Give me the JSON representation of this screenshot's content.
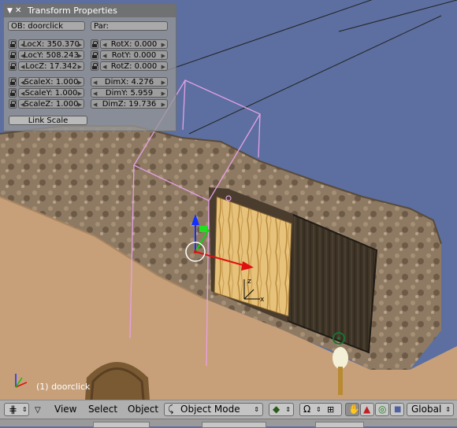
{
  "panel": {
    "title": "Transform Properties",
    "object_name": "OB: doorclick",
    "parent": "Par:",
    "loc": [
      "LocX: 350.370",
      "LocY: 508.243",
      "LocZ: 17.342"
    ],
    "rot": [
      "RotX: 0.000",
      "RotY: 0.000",
      "RotZ: 0.000"
    ],
    "scale": [
      "ScaleX: 1.000",
      "ScaleY: 1.000",
      "ScaleZ: 1.000"
    ],
    "dim": [
      "DimX: 4.276",
      "DimY: 5.959",
      "DimZ: 19.736"
    ],
    "link_scale": "Link Scale"
  },
  "viewport": {
    "status": "(1) doorclick"
  },
  "header": {
    "view": "View",
    "select": "Select",
    "object": "Object",
    "mode": "Object Mode",
    "orientation": "Global"
  },
  "icons": [
    "grid-icon",
    "menu-triangle-icon",
    "object-mode-icon",
    "pivot-icon",
    "snap-magnet-icon",
    "manipulator-icon",
    "hand-icon",
    "rotate-icon",
    "scale-icon",
    "axis-gizmo-icon"
  ],
  "colors": {
    "sky": "#5c6fa0",
    "floor": "#c7a07a",
    "panel": "#969696",
    "header": "#b0b0b0",
    "bbox": "#e6a0e6"
  }
}
